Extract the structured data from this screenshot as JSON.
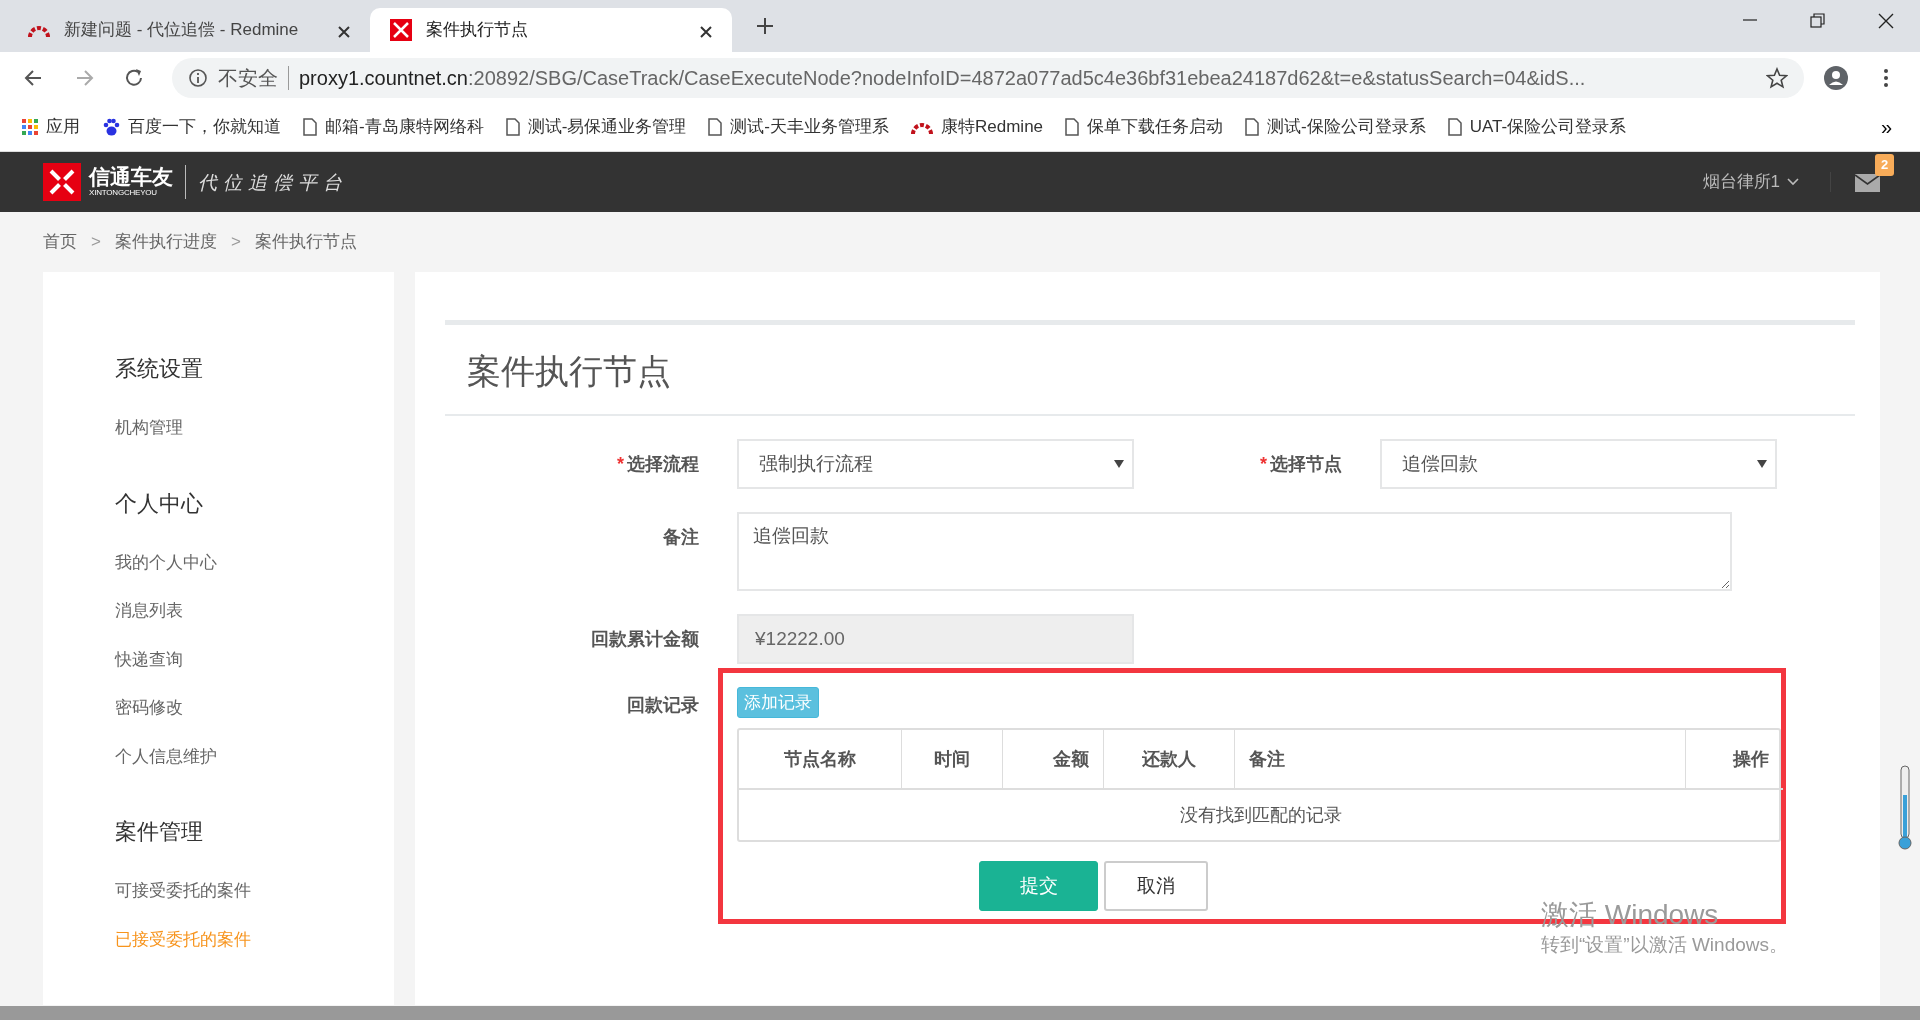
{
  "browser": {
    "tabs": [
      {
        "title": "新建问题 - 代位追偿 - Redmine",
        "selected": false
      },
      {
        "title": "案件执行节点",
        "selected": true
      }
    ],
    "address": {
      "security": "不安全",
      "host": "proxy1.countnet.cn",
      "rest": ":20892/SBG/CaseTrack/CaseExecuteNode?nodeInfoID=4872a077ad5c4e36bf31ebea24187d62&t=e&statusSearch=04&idS..."
    },
    "bookmarks": [
      "应用",
      "百度一下，你就知道",
      "邮箱-青岛康特网络科",
      "测试-易保通业务管理",
      "测试-天丰业务管理系",
      "康特Redmine",
      "保单下载任务启动",
      "测试-保险公司登录系",
      "UAT-保险公司登录系"
    ],
    "bookmarks_more": "»"
  },
  "header": {
    "brand": "信通车友",
    "brand_sub": "XINTONGCHEYOU",
    "slogan": "代位追偿平台",
    "user": "烟台律所1",
    "mail_count": "2"
  },
  "breadcrumb": [
    "首页",
    "案件执行进度",
    "案件执行节点"
  ],
  "breadcrumb_separator": ">",
  "sidebar": [
    {
      "title": "系统设置",
      "items": [
        {
          "label": "机构管理",
          "selected": false
        }
      ]
    },
    {
      "title": "个人中心",
      "items": [
        {
          "label": "我的个人中心",
          "selected": false
        },
        {
          "label": "消息列表",
          "selected": false
        },
        {
          "label": "快递查询",
          "selected": false
        },
        {
          "label": "密码修改",
          "selected": false
        },
        {
          "label": "个人信息维护",
          "selected": false
        }
      ]
    },
    {
      "title": "案件管理",
      "items": [
        {
          "label": "可接受委托的案件",
          "selected": false
        },
        {
          "label": "已接受委托的案件",
          "selected": true
        }
      ]
    }
  ],
  "page_title": "案件执行节点",
  "form": {
    "process": {
      "label": "选择流程",
      "required_mark": "*",
      "value": "强制执行流程"
    },
    "node": {
      "label": "选择节点",
      "required_mark": "*",
      "value": "追偿回款"
    },
    "remark": {
      "label": "备注",
      "value": "追偿回款"
    },
    "total": {
      "label": "回款累计金额",
      "value": "¥12222.00",
      "disabled": true
    },
    "records": {
      "label": "回款记录",
      "add_button": "添加记录",
      "columns": [
        "节点名称",
        "时间",
        "金额",
        "还款人",
        "备注",
        "操作"
      ],
      "empty_text": "没有找到匹配的记录"
    },
    "buttons": [
      {
        "label": "提交",
        "kind": "primary"
      },
      {
        "label": "取消",
        "kind": "default"
      }
    ]
  },
  "activation_notice": [
    "激活 Windows",
    "转到“设置”以激活 Windows。"
  ]
}
